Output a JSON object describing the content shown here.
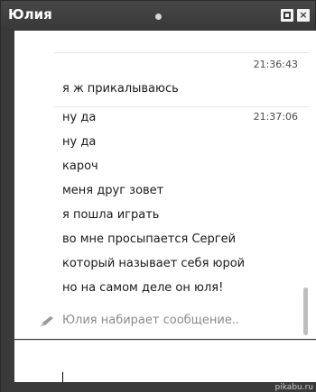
{
  "window": {
    "title": "Юлия",
    "restore_icon": "restore-icon",
    "close_label": "×"
  },
  "chat": {
    "groups": [
      {
        "time": "21:36:43",
        "messages": [
          "я ж прикалываюсь"
        ]
      },
      {
        "time": "21:37:06",
        "messages": [
          "ну да",
          "ну да",
          "кароч",
          "меня друг зовет",
          "я пошла играть",
          "во мне просыпается Сергей",
          "который называет себя юрой",
          "но на самом деле он юля!"
        ]
      }
    ],
    "typing_status": "Юлия набирает сообщение.."
  },
  "input": {
    "value": ""
  },
  "watermark": "pikabu.ru"
}
